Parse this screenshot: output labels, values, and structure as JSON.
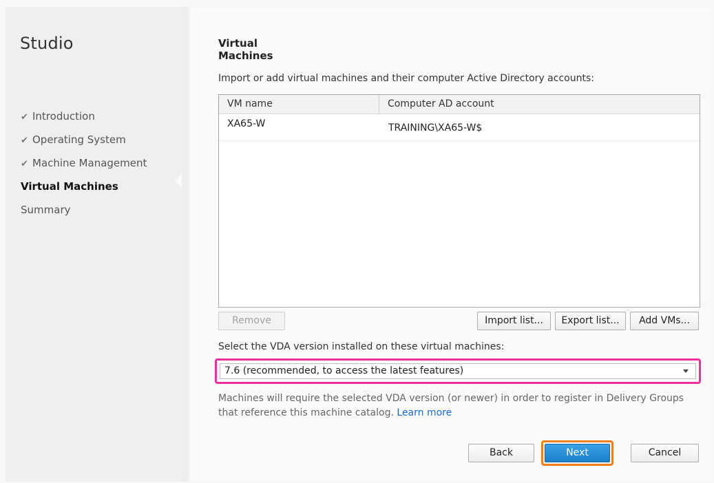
{
  "app": {
    "title": "Studio"
  },
  "nav": {
    "items": [
      {
        "label": "Introduction",
        "done": true
      },
      {
        "label": "Operating System",
        "done": true
      },
      {
        "label": "Machine Management",
        "done": true
      },
      {
        "label": "Virtual Machines",
        "done": false,
        "current": true
      },
      {
        "label": "Summary",
        "done": false
      }
    ],
    "check_glyph": "✔"
  },
  "page": {
    "heading": "Virtual Machines",
    "intro": "Import or add virtual machines and their computer Active Directory accounts:"
  },
  "table": {
    "columns": [
      "VM name",
      "Computer AD account"
    ],
    "rows": [
      {
        "vm_name": "XA65-W",
        "ad_account": "TRAINING\\XA65-W$"
      }
    ]
  },
  "table_buttons": {
    "remove": "Remove",
    "import": "Import list...",
    "export": "Export list...",
    "add": "Add VMs..."
  },
  "vda": {
    "label": "Select the VDA version installed on these virtual machines:",
    "selected": "7.6 (recommended, to access the latest features)",
    "info": "Machines will require the selected VDA version (or newer) in order to register in Delivery Groups that reference this machine catalog.",
    "learn_more": "Learn more"
  },
  "footer": {
    "back": "Back",
    "next": "Next",
    "cancel": "Cancel"
  },
  "colors": {
    "highlight_select": "#ee2e9a",
    "highlight_next": "#f07e1b",
    "primary_button": "#1a80cc",
    "link": "#1a6cc6"
  }
}
